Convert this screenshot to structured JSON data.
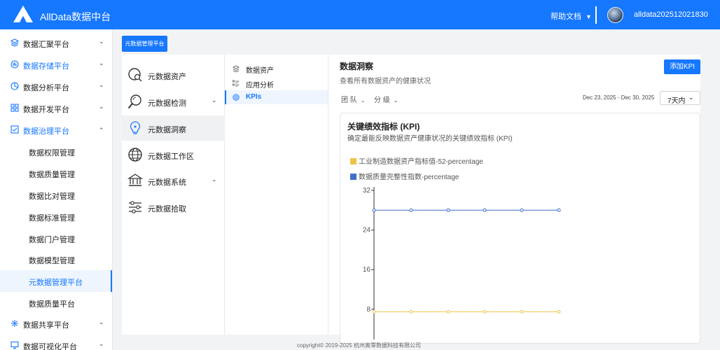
{
  "app": {
    "title": "AllData数据中台"
  },
  "header": {
    "help_label": "帮助文档",
    "help_caret": "▼",
    "username": "alldata202512021830"
  },
  "sidebar": {
    "items": [
      {
        "label": "数据汇聚平台",
        "icon": "layers-icon",
        "chevron": "⌄"
      },
      {
        "label": "数据存储平台",
        "icon": "storage-icon",
        "chevron": "⌄"
      },
      {
        "label": "数据分析平台",
        "icon": "analysis-icon",
        "chevron": "⌄"
      },
      {
        "label": "数据开发平台",
        "icon": "dev-grid-icon",
        "chevron": "⌄"
      },
      {
        "label": "数据治理平台",
        "icon": "governance-icon",
        "chevron": "⌃"
      },
      {
        "label": "数据共享平台",
        "icon": "share-icon",
        "chevron": "⌄"
      },
      {
        "label": "数据可视化平台",
        "icon": "monitor-icon",
        "chevron": "⌄"
      }
    ],
    "subitems": [
      {
        "label": "数据权限管理"
      },
      {
        "label": "数据质量管理"
      },
      {
        "label": "数据比对管理"
      },
      {
        "label": "数据标准管理"
      },
      {
        "label": "数据门户管理"
      },
      {
        "label": "数据模型管理"
      },
      {
        "label": "元数据管理平台"
      },
      {
        "label": "数据质量平台"
      }
    ]
  },
  "platform_button": "元数据管理平台",
  "column1": {
    "items": [
      {
        "label": "元数据资产",
        "icon": "asset-search-icon"
      },
      {
        "label": "元数据检测",
        "icon": "magnifier-icon",
        "chevron": "⌄"
      },
      {
        "label": "元数据洞察",
        "icon": "lightbulb-icon"
      },
      {
        "label": "元数据工作区",
        "icon": "globe-icon"
      },
      {
        "label": "元数据系统",
        "icon": "bank-icon",
        "chevron": "⌄"
      },
      {
        "label": "元数据拾取",
        "icon": "sliders-icon"
      }
    ]
  },
  "column2": {
    "items": [
      {
        "label": "数据资产",
        "icon": "stack-icon"
      },
      {
        "label": "应用分析",
        "icon": "list-icon"
      },
      {
        "label": "KPIs",
        "icon": "target-icon"
      }
    ]
  },
  "insight": {
    "title": "数据洞察",
    "subtitle": "查看所有数据资产的健康状况",
    "add_kpi": "添加KPI",
    "filters": [
      {
        "label": "团 队",
        "chevron": "⌄"
      },
      {
        "label": "分 级",
        "chevron": "⌄"
      }
    ],
    "date_range": "Dec 23, 2025 - Dec 30, 2025",
    "range_select": "7天内",
    "range_chevron": "⌄"
  },
  "kpi_card": {
    "title": "关键绩效指标 (KPI)",
    "subtitle": "确定最能反映数据资产健康状况的关键绩效指标 (KPI)"
  },
  "chart_data": {
    "type": "line",
    "x": [
      1,
      2,
      3,
      4,
      5,
      6
    ],
    "ylim": [
      6,
      32
    ],
    "yticks": [
      8,
      16,
      24,
      32
    ],
    "grid": false,
    "legend_placement": "top-left",
    "series": [
      {
        "name": "工业制造数据资产指标值-52-percentage",
        "color": "#f0c24a",
        "values": [
          7.5,
          7.5,
          7.5,
          7.5,
          7.5,
          7.5
        ]
      },
      {
        "name": "数据质量完整性指数-percentage",
        "color": "#3e6fc9",
        "values": [
          28,
          28,
          28,
          28,
          28,
          28
        ]
      }
    ]
  },
  "footer": {
    "text": "copyright© 2019-2025 杭州奥零数据科技有限公司"
  }
}
